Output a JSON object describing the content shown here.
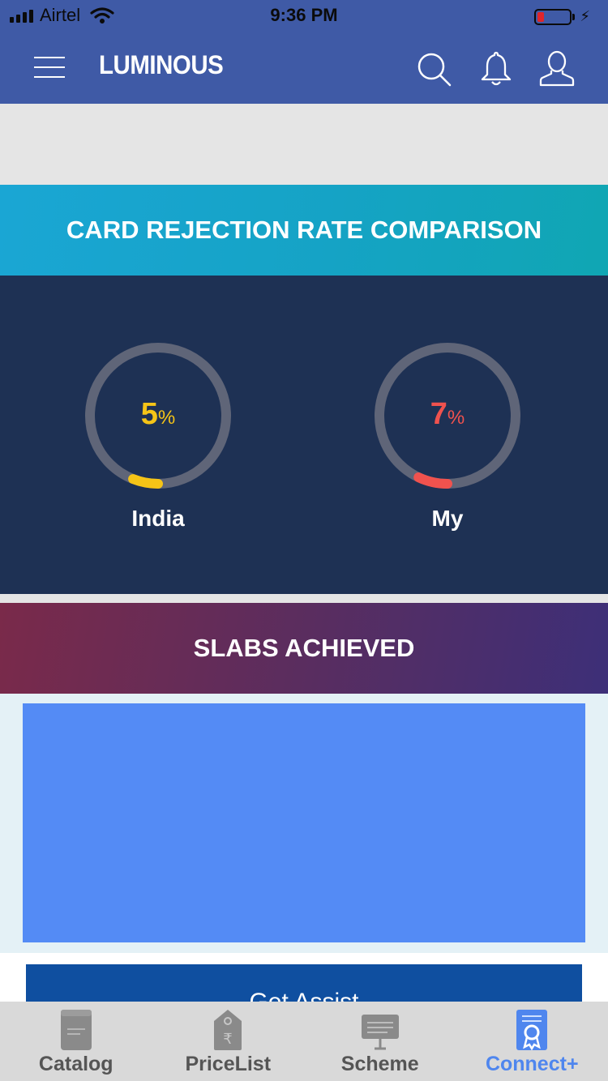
{
  "status_bar": {
    "carrier": "Airtel",
    "time": "9:36 PM"
  },
  "app": {
    "brand": "LUMINOUS"
  },
  "comparison": {
    "title": "CARD REJECTION RATE COMPARISON",
    "gauges": [
      {
        "label": "India",
        "value": "5",
        "unit": "%",
        "color": "#f5c417",
        "fraction": 0.05
      },
      {
        "label": "My",
        "value": "7",
        "unit": "%",
        "color": "#f0524e",
        "fraction": 0.07
      }
    ],
    "track_color": "#5f6578"
  },
  "slabs": {
    "title": "SLABS ACHIEVED",
    "box_color": "#548bf5"
  },
  "assist_button": {
    "label": "Get Assist"
  },
  "tabs": [
    {
      "label": "Catalog",
      "icon": "catalog-icon"
    },
    {
      "label": "PriceList",
      "icon": "price-tag-icon"
    },
    {
      "label": "Scheme",
      "icon": "scheme-board-icon"
    },
    {
      "label": "Connect+",
      "icon": "certificate-icon",
      "active": true
    }
  ]
}
